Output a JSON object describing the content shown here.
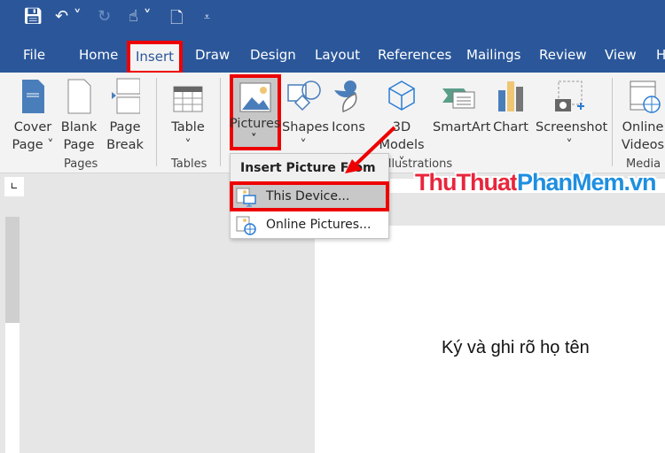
{
  "quick_access": {
    "icons": [
      "save-icon",
      "undo-icon",
      "redo-icon",
      "touch-mode-icon",
      "new-document-icon",
      "customize-icon"
    ]
  },
  "tabs": [
    "File",
    "Home",
    "Insert",
    "Draw",
    "Design",
    "Layout",
    "References",
    "Mailings",
    "Review",
    "View",
    "Help"
  ],
  "active_tab": "Insert",
  "ribbon": {
    "buttons": {
      "cover_page": "Cover Page",
      "blank_page": "Blank Page",
      "page_break": "Page Break",
      "table": "Table",
      "pictures": "Pictures",
      "shapes": "Shapes",
      "icons": "Icons",
      "models_3d": "3D Models",
      "smartart": "SmartArt",
      "chart": "Chart",
      "screenshot": "Screenshot",
      "online_videos": "Online Videos"
    },
    "groups": {
      "pages": "Pages",
      "tables": "Tables",
      "illustrations": "Illustrations",
      "media": "Media"
    }
  },
  "menu": {
    "header": "Insert Picture From",
    "items": [
      "This Device...",
      "Online Pictures..."
    ]
  },
  "watermark": {
    "part1": "ThuThuat",
    "part2": "PhanMem.vn"
  },
  "document": {
    "text": "Ký và ghi rõ họ tên"
  },
  "colors": {
    "title_bar": "#2b579a",
    "highlight": "#ee0000"
  }
}
